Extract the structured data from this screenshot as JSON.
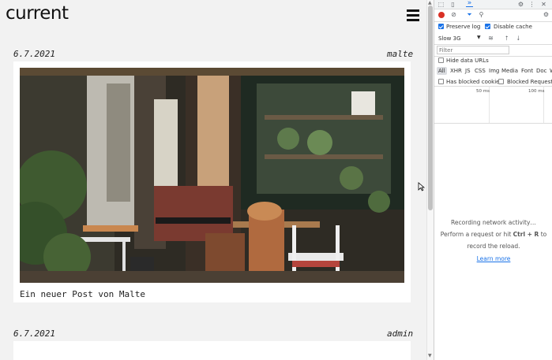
{
  "site": {
    "logo": "current",
    "posts": [
      {
        "date": "6.7.2021",
        "author": "malte",
        "caption": "Ein neuer Post von Malte"
      },
      {
        "date": "6.7.2021",
        "author": "admin"
      }
    ]
  },
  "devtools": {
    "throttle": "Slow 3G",
    "filter_placeholder": "Filter",
    "preserve_log": "Preserve log",
    "disable_cache": "Disable cache",
    "hide_data_urls": "Hide data URLs",
    "types": [
      "All",
      "XHR",
      "JS",
      "CSS",
      "Img",
      "Media",
      "Font",
      "Doc",
      "W"
    ],
    "has_blocked_cookies": "Has blocked cookies",
    "blocked_requests": "Blocked Requests",
    "waterfall_labels": [
      "50 ms",
      "100 ms"
    ],
    "empty_line1": "Recording network activity…",
    "empty_line2_pre": "Perform a request or hit ",
    "empty_line2_key": "Ctrl + R",
    "empty_line2_post": " to",
    "empty_line3": "record the reload.",
    "learn_more": "Learn more",
    "more_tabs": "»",
    "colors": {
      "record": "#d93025",
      "accent": "#1a73e8"
    }
  }
}
